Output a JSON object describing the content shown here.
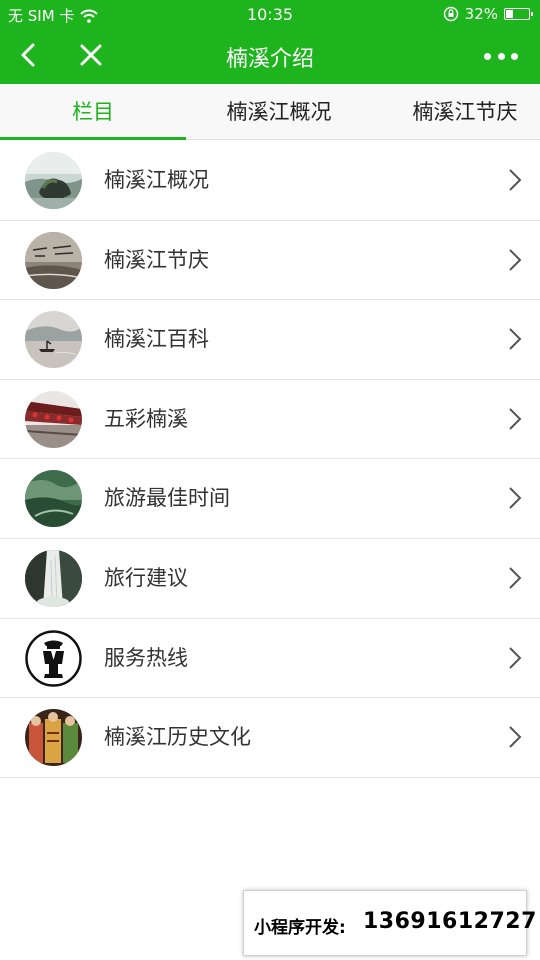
{
  "status_bar": {
    "carrier": "无 SIM 卡",
    "time": "10:35",
    "battery_percent": "32%",
    "battery_level": 0.32,
    "icons": [
      "wifi-icon",
      "orientation-lock-icon",
      "battery-icon"
    ]
  },
  "navbar": {
    "title": "楠溪介绍",
    "icons": [
      "back-chevron-icon",
      "close-icon",
      "more-icon"
    ]
  },
  "tabs": [
    {
      "label": "栏目",
      "active": true
    },
    {
      "label": "楠溪江概况",
      "active": false
    },
    {
      "label": "楠溪江节庆",
      "active": false
    }
  ],
  "list": {
    "items": [
      {
        "label": "楠溪江概况",
        "thumb": "landscape-rock"
      },
      {
        "label": "楠溪江节庆",
        "thumb": "calligraphy"
      },
      {
        "label": "楠溪江百科",
        "thumb": "misty-river"
      },
      {
        "label": "五彩楠溪",
        "thumb": "red-lanterns"
      },
      {
        "label": "旅游最佳时间",
        "thumb": "green-valley"
      },
      {
        "label": "旅行建议",
        "thumb": "waterfall"
      },
      {
        "label": "服务热线",
        "thumb": "attendant-icon"
      },
      {
        "label": "楠溪江历史文化",
        "thumb": "opera-costume"
      }
    ]
  },
  "footer": {
    "label": "小程序开发:",
    "phone": "13691612727"
  },
  "colors": {
    "brand_green": "#1db41d",
    "text_dark": "#333333",
    "divider": "#e5e5e5"
  }
}
